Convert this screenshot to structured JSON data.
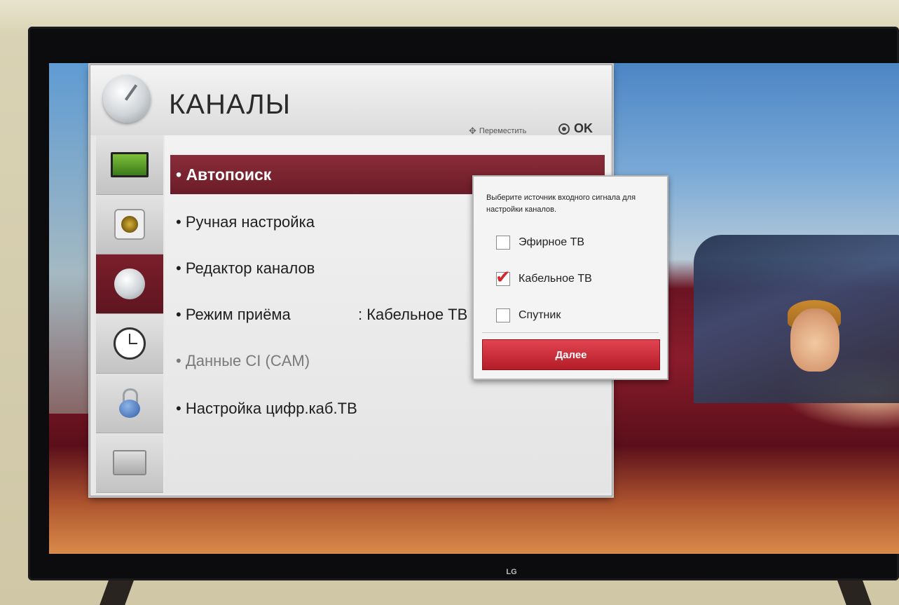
{
  "menu": {
    "title": "КАНАЛЫ",
    "hint_move": "Переместить",
    "hint_ok": "OK",
    "items": [
      {
        "label": "• Автопоиск",
        "value": "",
        "selected": true
      },
      {
        "label": "• Ручная настройка",
        "value": ""
      },
      {
        "label": "• Редактор каналов",
        "value": ""
      },
      {
        "label": "• Режим приёма",
        "value": ": Кабельное ТВ"
      },
      {
        "label": "• Данные CI (CAM)",
        "value": "",
        "disabled": true
      },
      {
        "label": "• Настройка цифр.каб.ТВ",
        "value": ""
      }
    ],
    "categories": [
      {
        "icon": "picture-tv-icon"
      },
      {
        "icon": "sound-speaker-icon"
      },
      {
        "icon": "channels-dish-icon",
        "active": true
      },
      {
        "icon": "time-clock-icon"
      },
      {
        "icon": "lock-icon"
      },
      {
        "icon": "options-toolbox-icon"
      }
    ]
  },
  "dialog": {
    "prompt": "Выберите источник входного сигнала для настройки каналов.",
    "options": [
      {
        "label": "Эфирное ТВ",
        "checked": false
      },
      {
        "label": "Кабельное ТВ",
        "checked": true
      },
      {
        "label": "Спутник",
        "checked": false
      }
    ],
    "next_label": "Далее"
  },
  "tv": {
    "brand": "LG"
  },
  "colors": {
    "accent": "#7a1f2b",
    "button": "#c9252f",
    "check": "#d2282e"
  }
}
